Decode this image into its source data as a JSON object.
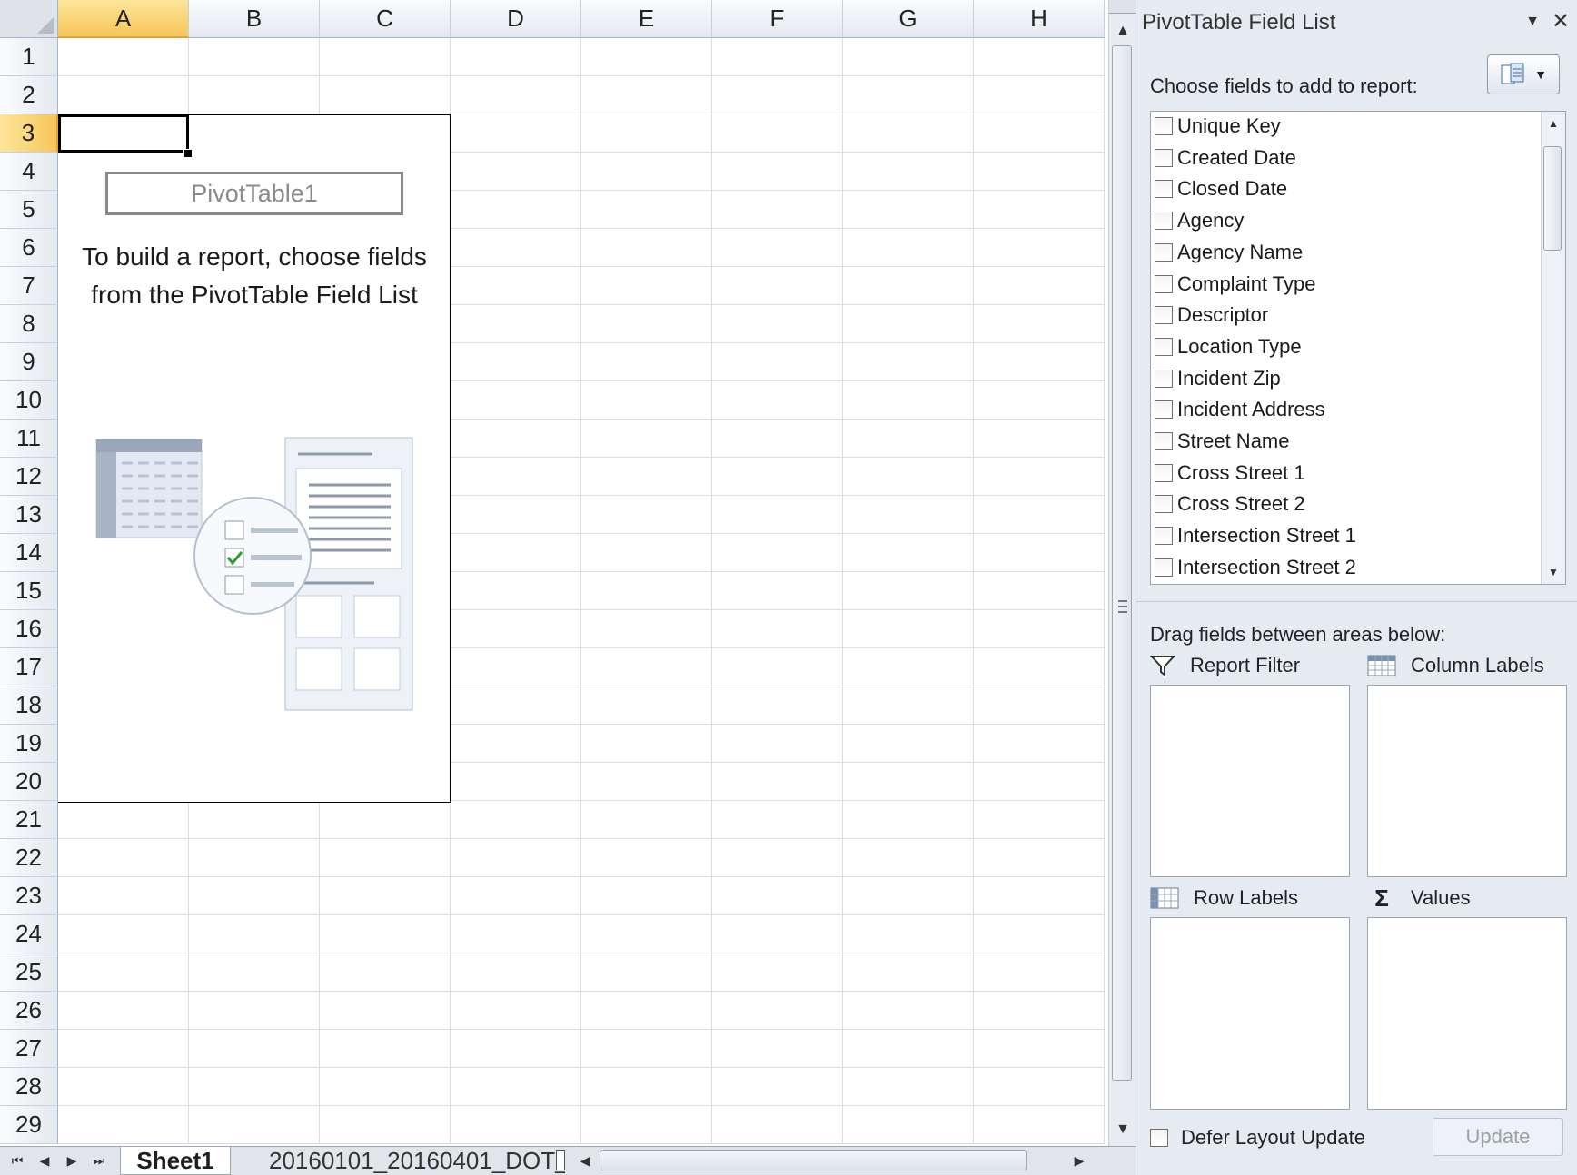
{
  "spreadsheet": {
    "columns": [
      "A",
      "B",
      "C",
      "D",
      "E",
      "F",
      "G",
      "H"
    ],
    "rows": [
      "1",
      "2",
      "3",
      "4",
      "5",
      "6",
      "7",
      "8",
      "9",
      "10",
      "11",
      "12",
      "13",
      "14",
      "15",
      "16",
      "17",
      "18",
      "19",
      "20",
      "21",
      "22",
      "23",
      "24",
      "25",
      "26",
      "27",
      "28",
      "29"
    ],
    "selected_column": "A",
    "selected_row": "3"
  },
  "pivot": {
    "name": "PivotTable1",
    "message_line1": "To build a report, choose fields",
    "message_line2": "from the PivotTable Field List"
  },
  "sheet_tabs": {
    "active": "Sheet1",
    "other": "20160101_20160401_DOT_"
  },
  "field_list": {
    "title": "PivotTable Field List",
    "choose_label": "Choose fields to add to report:",
    "fields": [
      "Unique Key",
      "Created Date",
      "Closed Date",
      "Agency",
      "Agency Name",
      "Complaint Type",
      "Descriptor",
      "Location Type",
      "Incident Zip",
      "Incident Address",
      "Street Name",
      "Cross Street 1",
      "Cross Street 2",
      "Intersection Street 1",
      "Intersection Street 2"
    ],
    "drag_label": "Drag fields between areas below:",
    "areas": {
      "report_filter": "Report Filter",
      "column_labels": "Column Labels",
      "row_labels": "Row Labels",
      "values": "Values"
    },
    "defer_label": "Defer Layout Update",
    "update_label": "Update"
  },
  "icons": {
    "filter": "filter-funnel-icon",
    "table_grid": "table-grid-icon",
    "sigma": "sigma-icon"
  },
  "colors": {
    "selected_header": "#f7c65a",
    "pane_background": "#e6ebf2",
    "check_green": "#2e9e2e"
  }
}
